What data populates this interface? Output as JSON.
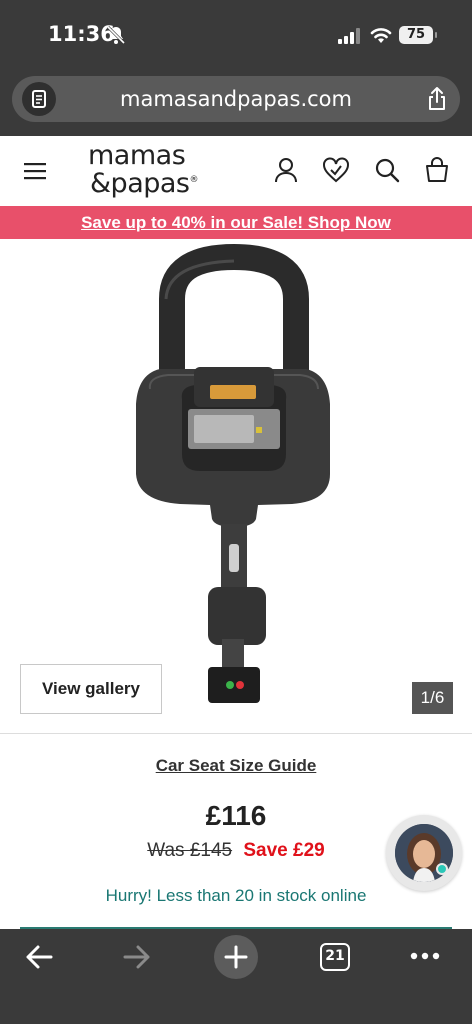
{
  "status_bar": {
    "time": "11:36",
    "battery": "75"
  },
  "browser": {
    "url": "mamasandpapas.com",
    "tab_count": "21"
  },
  "header": {
    "logo_line1": "mamas",
    "logo_line2": "&papas",
    "logo_mark": "®"
  },
  "promo": {
    "text": "Save up to 40% in our Sale! Shop Now",
    "color": "#e8506a"
  },
  "gallery": {
    "button_label": "View gallery",
    "counter": "1/6"
  },
  "product": {
    "size_guide": "Car Seat Size Guide",
    "price": "£116",
    "was_price": "Was £145",
    "save_text": "Save £29",
    "stock_message": "Hurry! Less than 20 in stock online"
  },
  "icons": [
    "document-icon",
    "share-icon",
    "menu-icon",
    "account-icon",
    "wishlist-icon",
    "search-icon",
    "bag-icon",
    "back-icon",
    "forward-icon",
    "new-tab-icon",
    "tabs-icon",
    "more-icon",
    "chat-agent-icon"
  ],
  "colors": {
    "accent_pink": "#e8506a",
    "sale_red": "#e0111a",
    "stock_teal": "#1a7773"
  }
}
